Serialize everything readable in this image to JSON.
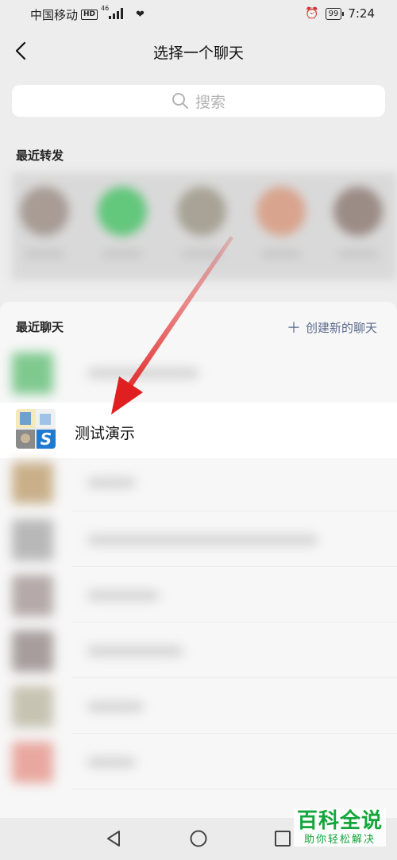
{
  "status_bar": {
    "carrier": "中国移动",
    "network_badge": "HD",
    "signal_label": "46",
    "battery": "99",
    "time": "7:24"
  },
  "header": {
    "title": "选择一个聊天"
  },
  "search": {
    "placeholder": "搜索"
  },
  "recent_forward": {
    "label": "最近转发"
  },
  "recent_chats": {
    "label": "最近聊天",
    "create_new": "创建新的聊天",
    "highlighted_chat": "测试演示"
  },
  "watermark": {
    "main": "百科全说",
    "sub": "助你轻松解决"
  },
  "colors": {
    "accent_link": "#5b6b8c",
    "watermark_green": "#12a63a",
    "arrow_red": "#e02020"
  }
}
